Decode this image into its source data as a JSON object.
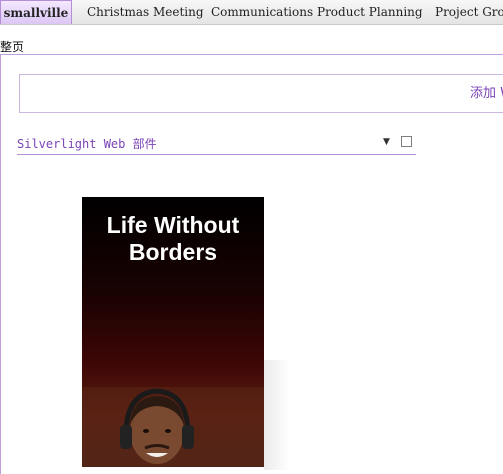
{
  "tabs": [
    {
      "label": "smallville"
    },
    {
      "label": "Christmas Meeting"
    },
    {
      "label": "Communications"
    },
    {
      "label": "Product Planning"
    },
    {
      "label": "Project Gro"
    }
  ],
  "page": {
    "label": "整页",
    "add_webpart_label": "添加 W"
  },
  "webpart": {
    "title": "Silverlight Web 部件",
    "menu_icon": "dropdown-arrow-icon",
    "checkbox_checked": false,
    "poster_title": "Life Without Borders"
  },
  "colors": {
    "accent": "#7a43b6",
    "border": "#b48fd6"
  }
}
